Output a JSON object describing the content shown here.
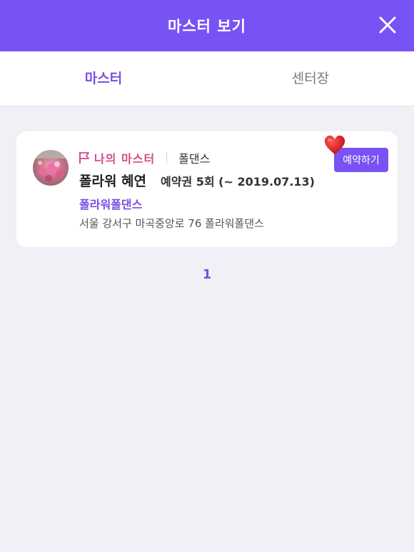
{
  "header": {
    "title": "마스터 보기",
    "close_icon": "close-icon",
    "background_color": "#7952f5"
  },
  "tabs": [
    {
      "label": "마스터",
      "active": true
    },
    {
      "label": "센터장",
      "active": false
    }
  ],
  "card": {
    "avatar_icon": "avatar",
    "flag_icon": "flag-icon",
    "my_master_label": "나의 마스터",
    "category": "폴댄스",
    "master_name": "폴라워 혜연",
    "ticket_info": "예약권 5회 (~ 2019.07.13)",
    "center_name": "폴라워폴댄스",
    "address": "서울 강서구 마곡중앙로 76 폴라워폴댄스",
    "reserve_button_label": "예약하기",
    "heart_icon": "heart-icon"
  },
  "pagination": {
    "current_page": "1"
  },
  "colors": {
    "accent": "#7952f5",
    "accent_text": "#7a4ee3",
    "pink": "#d44b8a",
    "background": "#f1f0f6"
  }
}
